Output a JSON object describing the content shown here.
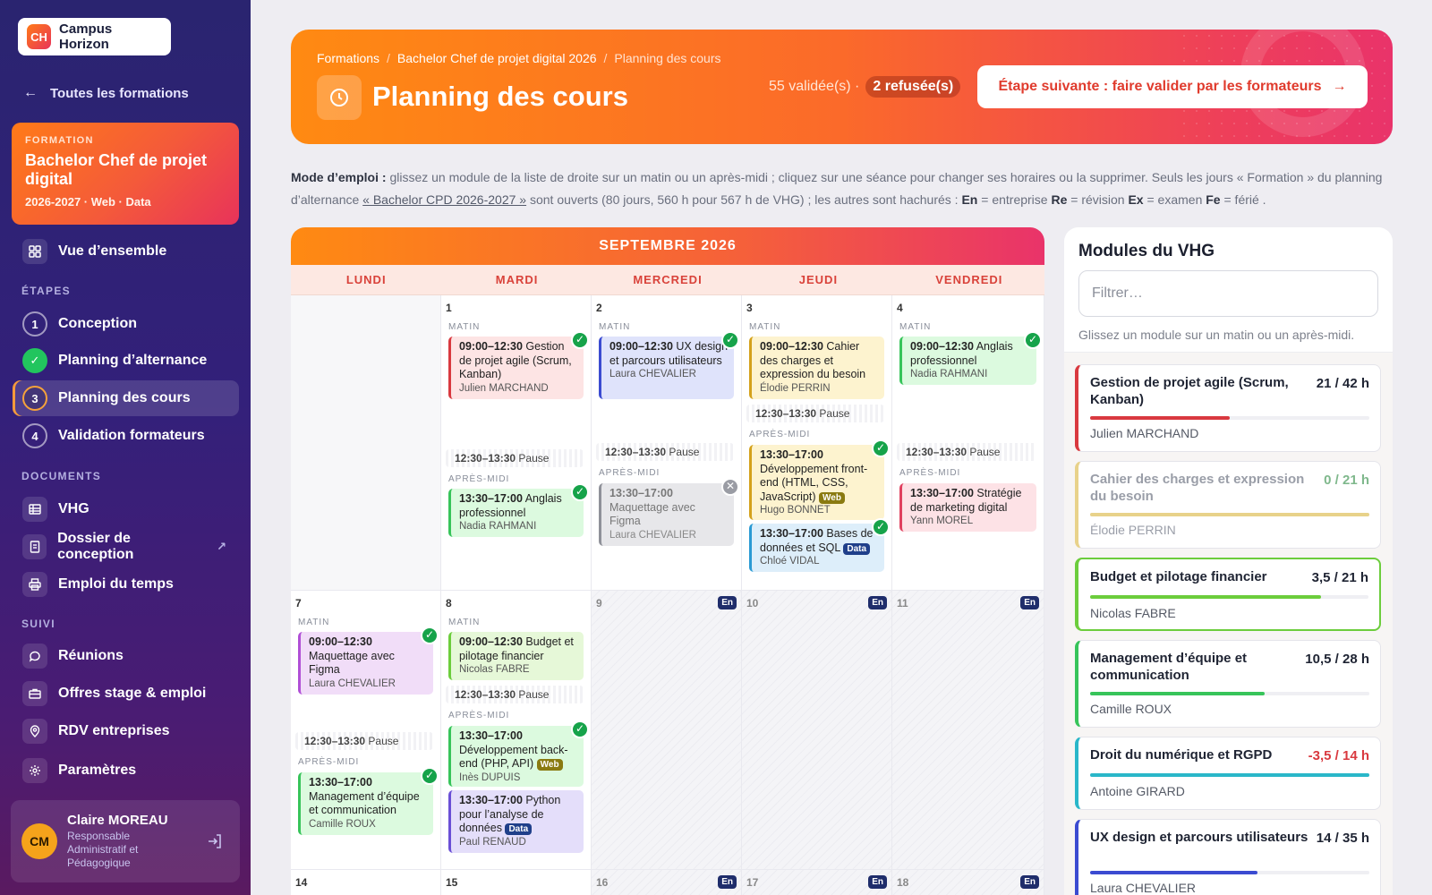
{
  "sidebar": {
    "logo_initials": "CH",
    "logo_text": "Campus Horizon",
    "back_label": "Toutes les formations",
    "formation": {
      "kicker": "FORMATION",
      "title": "Bachelor Chef de projet digital",
      "meta": "2026-2027 · Web · Data"
    },
    "overview_label": "Vue d’ensemble",
    "steps_label": "ÉTAPES",
    "steps": [
      {
        "num": "1",
        "label": "Conception"
      },
      {
        "num": "✓",
        "label": "Planning d’alternance"
      },
      {
        "num": "3",
        "label": "Planning des cours"
      },
      {
        "num": "4",
        "label": "Validation formateurs"
      }
    ],
    "documents_label": "DOCUMENTS",
    "documents": [
      {
        "label": "VHG"
      },
      {
        "label": "Dossier de conception",
        "ext": "↗"
      },
      {
        "label": "Emploi du temps"
      }
    ],
    "follow_label": "SUIVI",
    "follow": [
      {
        "label": "Réunions"
      },
      {
        "label": "Offres stage & emploi"
      },
      {
        "label": "RDV entreprises"
      },
      {
        "label": "Paramètres"
      }
    ],
    "user": {
      "initials": "CM",
      "name": "Claire MOREAU",
      "role": "Responsable Administratif et Pédagogique"
    }
  },
  "header": {
    "breadcrumbs": [
      "Formations",
      "Bachelor Chef de projet digital 2026",
      "Planning des cours"
    ],
    "breadcrumb_sep": "/",
    "title": "Planning des cours",
    "validated": "55 validée(s) ·",
    "refused": "2 refusée(s)",
    "next_button": "Étape suivante : faire valider par les formateurs",
    "next_arrow": "→"
  },
  "instructions": {
    "lead": "Mode d’emploi :",
    "p1": " glissez un module de la liste de droite sur un matin ou un après-midi ; cliquez sur une séance pour changer ses horaires ou la supprimer. Seuls les jours « Formation » du planning d’alternance ",
    "link": "« Bachelor CPD 2026-2027 »",
    "p2": " sont ouverts (80 jours, 560 h pour 567 h de VHG) ; les autres sont hachurés : ",
    "legend": [
      {
        "code": "En",
        "text": " = entreprise "
      },
      {
        "code": "Re",
        "text": " = révision "
      },
      {
        "code": "Ex",
        "text": " = examen "
      },
      {
        "code": "Fe",
        "text": " = férié ."
      }
    ]
  },
  "calendar": {
    "month": "SEPTEMBRE 2026",
    "weekdays": [
      "LUNDI",
      "MARDI",
      "MERCREDI",
      "JEUDI",
      "VENDREDI"
    ],
    "labels": {
      "morning": "MATIN",
      "afternoon": "APRÈS-MIDI",
      "pause_time": "12:30–13:30",
      "pause_text": "Pause",
      "enterprise": "En"
    },
    "days": {
      "d1": "1",
      "d2": "2",
      "d3": "3",
      "d4": "4",
      "d7": "7",
      "d8": "8",
      "d9": "9",
      "d10": "10",
      "d11": "11",
      "d14": "14",
      "d15": "15",
      "d16": "16",
      "d17": "17",
      "d18": "18"
    },
    "sessions": {
      "s1": {
        "time": "09:00–12:30",
        "title": "Gestion de projet agile (Scrum, Kanban)",
        "trainer": "Julien MARCHAND"
      },
      "s2": {
        "time": "13:30–17:00",
        "title": "Anglais professionnel",
        "trainer": "Nadia RAHMANI"
      },
      "s3": {
        "time": "09:00–12:30",
        "title": "UX design et parcours utilisateurs",
        "trainer": "Laura CHEVALIER"
      },
      "s4": {
        "time": "13:30–17:00",
        "title": "Maquettage avec Figma",
        "trainer": "Laura CHEVALIER"
      },
      "s5": {
        "time": "09:00–12:30",
        "title": "Cahier des charges et expression du besoin",
        "trainer": "Élodie PERRIN"
      },
      "s6": {
        "time": "13:30–17:00",
        "title": "Développement front-end (HTML, CSS, JavaScript)",
        "tag": "Web",
        "trainer": "Hugo BONNET"
      },
      "s7": {
        "time": "13:30–17:00",
        "title": "Bases de données et SQL",
        "tag": "Data",
        "trainer": "Chloé VIDAL"
      },
      "s8": {
        "time": "09:00–12:30",
        "title": "Anglais professionnel",
        "trainer": "Nadia RAHMANI"
      },
      "s9": {
        "time": "13:30–17:00",
        "title": "Stratégie de marketing digital",
        "trainer": "Yann MOREL"
      },
      "s10": {
        "time": "09:00–12:30",
        "title": "Maquettage avec Figma",
        "trainer": "Laura CHEVALIER"
      },
      "s11": {
        "time": "13:30–17:00",
        "title": "Management d’équipe et communication",
        "trainer": "Camille ROUX"
      },
      "s12": {
        "time": "09:00–12:30",
        "title": "Budget et pilotage financier",
        "trainer": "Nicolas FABRE"
      },
      "s13": {
        "time": "13:30–17:00",
        "title": "Développement back-end (PHP, API)",
        "tag": "Web",
        "trainer": "Inès DUPUIS"
      },
      "s14": {
        "time": "13:30–17:00",
        "title": "Python pour l’analyse de données",
        "tag": "Data",
        "trainer": "Paul RENAUD"
      }
    }
  },
  "modules": {
    "title": "Modules du VHG",
    "filter_placeholder": "Filtrer…",
    "hint": "Glissez un module sur un matin ou un après-midi.",
    "items": [
      {
        "name": "Gestion de projet agile (Scrum, Kanban)",
        "hours": "21 / 42 h",
        "trainer": "Julien MARCHAND",
        "progress": 0.5,
        "color": "#d9393f"
      },
      {
        "name": "Cahier des charges et expression du besoin",
        "hours": "0 / 21 h",
        "trainer": "Élodie PERRIN",
        "progress": 1.0,
        "color": "#e8d28a"
      },
      {
        "name": "Budget et pilotage financier",
        "hours": "3,5 / 21 h",
        "trainer": "Nicolas FABRE",
        "progress": 0.83,
        "color": "#6ccd3c"
      },
      {
        "name": "Management d’équipe et communication",
        "hours": "10,5 / 28 h",
        "trainer": "Camille ROUX",
        "progress": 0.625,
        "color": "#37c45a"
      },
      {
        "name": "Droit du numérique et RGPD",
        "hours": "-3,5 / 14 h",
        "trainer": "Antoine GIRARD",
        "progress": 1.0,
        "color": "#2ab7c9",
        "hours_color": "#d9393f"
      },
      {
        "name": "UX design et parcours utilisateurs",
        "hours": "14 / 35 h",
        "trainer": "Laura CHEVALIER",
        "progress": 0.6,
        "color": "#3b4bd1"
      }
    ]
  },
  "colors": {
    "accent_orange": "#ff8a12",
    "accent_pink": "#e9336a",
    "sidebar_bg": "#2a2470",
    "validated_green": "#16a34a"
  }
}
